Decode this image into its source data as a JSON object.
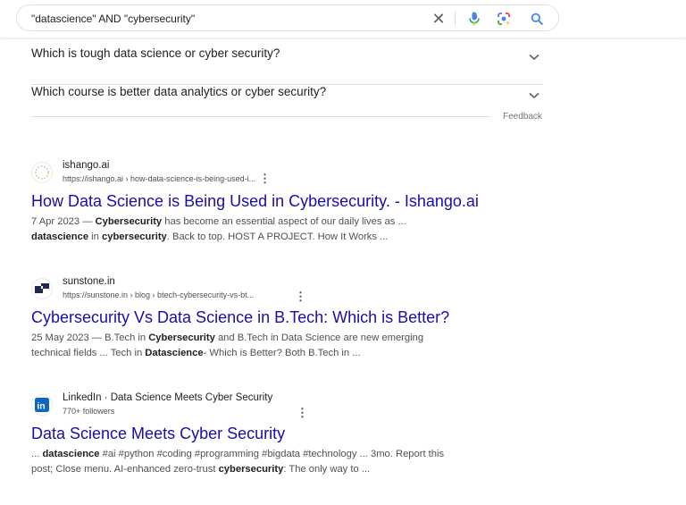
{
  "search": {
    "query": "\"datascience\" AND \"cybersecurity\"",
    "clear_icon": "close-icon",
    "mic_icon": "microphone-icon",
    "lens_icon": "google-lens-icon",
    "search_icon": "search-icon"
  },
  "people_also_ask": [
    {
      "question": "Which is tough data science or cyber security?"
    },
    {
      "question": "Which course is better data analytics or cyber security?"
    }
  ],
  "feedback_label": "Feedback",
  "results": [
    {
      "site_name": "ishango.ai",
      "url": "https://ishango.ai › how-data-science-is-being-used-i...",
      "title": "How Data Science is Being Used in Cybersecurity. - Ishango.ai",
      "snippet": [
        [
          {
            "t": "7 Apr 2023 — ",
            "b": false
          },
          {
            "t": "Cybersecurity",
            "b": true
          },
          {
            "t": " has become an essential aspect of our daily lives as ...",
            "b": false
          }
        ],
        [
          {
            "t": "datascience",
            "b": true
          },
          {
            "t": " in ",
            "b": false
          },
          {
            "t": "cybersecurity",
            "b": true
          },
          {
            "t": ". Back to top. HOST A PROJECT. How It Works ...",
            "b": false
          }
        ]
      ]
    },
    {
      "site_name": "sunstone.in",
      "url": "https://sunstone.in › blog › btech-cybersecurity-vs-bt...",
      "title": "Cybersecurity Vs Data Science in B.Tech: Which is Better?",
      "snippet": [
        [
          {
            "t": "25 May 2023 — B.Tech in ",
            "b": false
          },
          {
            "t": "Cybersecurity",
            "b": true
          },
          {
            "t": " and B.Tech in Data Science are new emerging",
            "b": false
          }
        ],
        [
          {
            "t": "technical fields ... Tech in ",
            "b": false
          },
          {
            "t": "Datascience",
            "b": true
          },
          {
            "t": "- Which is Better? Both B.Tech in ...",
            "b": false
          }
        ]
      ]
    },
    {
      "site_name": "LinkedIn · Data Science Meets Cyber Security",
      "url": "770+ followers",
      "title": "Data Science Meets Cyber Security",
      "snippet": [
        [
          {
            "t": "... ",
            "b": false
          },
          {
            "t": "datascience",
            "b": true
          },
          {
            "t": " #ai #python #coding #programming #bigdata #technology ... 3mo. Report this",
            "b": false
          }
        ],
        [
          {
            "t": "post; Close menu. AI-enhanced zero-trust ",
            "b": false
          },
          {
            "t": "cybersecurity",
            "b": true
          },
          {
            "t": ": The only way to ...",
            "b": false
          }
        ]
      ]
    }
  ],
  "colors": {
    "link": "#1a0dab",
    "mic_blue": "#4285f4",
    "mic_red": "#ea4335",
    "linkedin_blue": "#0a66c2",
    "sunstone_navy": "#1b2a4e"
  }
}
